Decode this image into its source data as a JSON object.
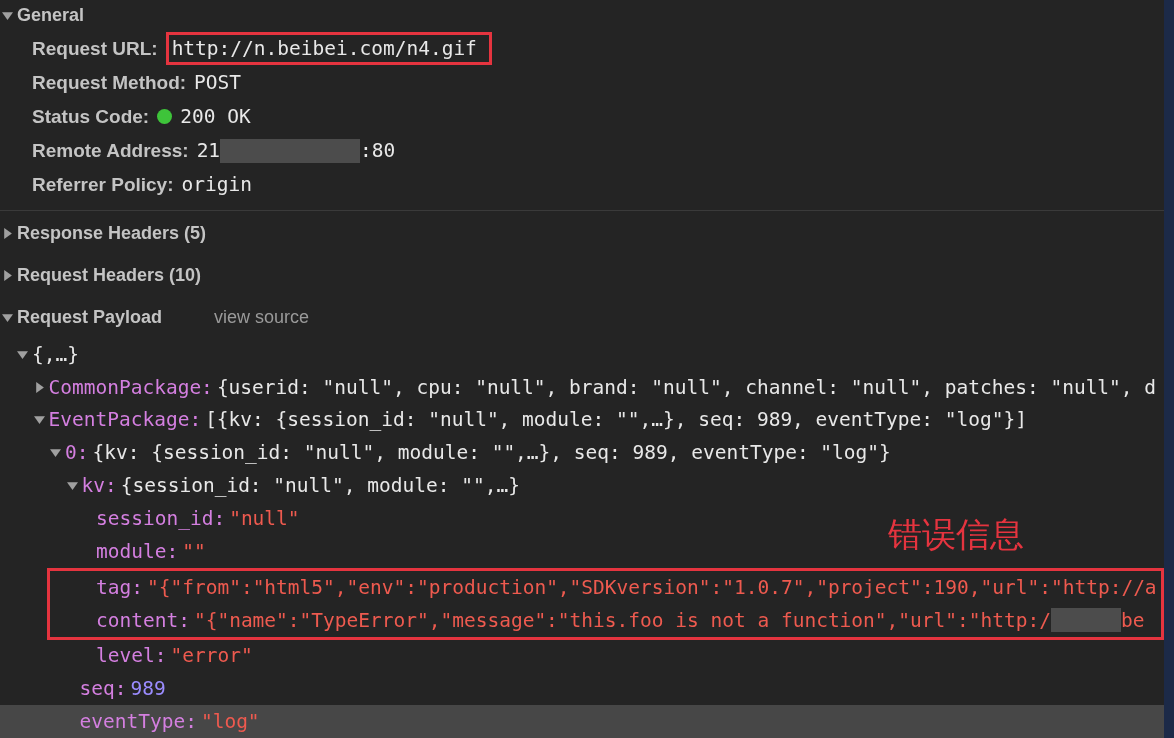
{
  "general": {
    "title": "General",
    "expanded": true,
    "fields": [
      {
        "label": "Request URL:",
        "value": "http://n.beibei.com/n4.gif",
        "highlighted": true
      },
      {
        "label": "Request Method:",
        "value": "POST"
      },
      {
        "label": "Status Code:",
        "value": "200 OK",
        "color": "#3ec43a"
      },
      {
        "label": "Remote Address:",
        "segments": [
          {
            "kind": "text",
            "text": "21"
          },
          {
            "kind": "redacted"
          },
          {
            "kind": "text",
            "text": ":80"
          }
        ]
      },
      {
        "label": "Referrer Policy:",
        "value": "origin"
      }
    ]
  },
  "sections": [
    {
      "title": "Response Headers (5)",
      "expanded": false
    },
    {
      "title": "Request Headers (10)",
      "expanded": false
    },
    {
      "title": "Request Payload",
      "expanded": true,
      "link": "view source"
    }
  ],
  "payload": {
    "annotation": "错误信息",
    "tree": [
      {
        "value": "{,…}",
        "kind": "preview",
        "expanded": true,
        "selected": false,
        "children": [
          {
            "key": "CommonPackage:",
            "value": "{userid: \"null\", cpu: \"null\", brand: \"null\", channel: \"null\", patches: \"null\", d",
            "kind": "preview",
            "expanded": false,
            "selected": false
          },
          {
            "key": "EventPackage:",
            "value": "[{kv: {session_id: \"null\", module: \"\",…}, seq: 989, eventType: \"log\"}]",
            "kind": "preview",
            "expanded": true,
            "selected": false,
            "children": [
              {
                "key": "0:",
                "value": "{kv: {session_id: \"null\", module: \"\",…}, seq: 989, eventType: \"log\"}",
                "kind": "preview",
                "expanded": true,
                "selected": false,
                "children": [
                  {
                    "key": "kv:",
                    "value": "{session_id: \"null\", module: \"\",…}",
                    "kind": "preview",
                    "expanded": true,
                    "selected": false,
                    "children": [
                      {
                        "key": "session_id:",
                        "value": "\"null\"",
                        "kind": "string",
                        "selected": false
                      },
                      {
                        "key": "module:",
                        "value": "\"\"",
                        "kind": "string",
                        "selected": false
                      },
                      {
                        "key": "tag:",
                        "value": "\"{\"from\":\"html5\",\"env\":\"production\",\"SDKversion\":\"1.0.7\",\"project\":190,\"url\":\"http://a",
                        "kind": "string",
                        "selected": false,
                        "highlighted": true
                      },
                      {
                        "key": "content:",
                        "segments": [
                          {
                            "kind": "text",
                            "text": "\"{\"name\":\"TypeError\",\"message\":\"this.foo is not a function\",\"url\":\"http:/"
                          },
                          {
                            "kind": "redacted"
                          },
                          {
                            "kind": "text",
                            "text": "be"
                          }
                        ],
                        "kind": "string",
                        "selected": false,
                        "highlighted": true
                      },
                      {
                        "key": "level:",
                        "value": "\"error\"",
                        "kind": "string",
                        "selected": false
                      }
                    ]
                  },
                  {
                    "key": "seq:",
                    "value": "989",
                    "kind": "number",
                    "selected": false
                  },
                  {
                    "key": "eventType:",
                    "value": "\"log\"",
                    "kind": "string",
                    "selected": true
                  }
                ]
              }
            ]
          }
        ]
      }
    ]
  }
}
